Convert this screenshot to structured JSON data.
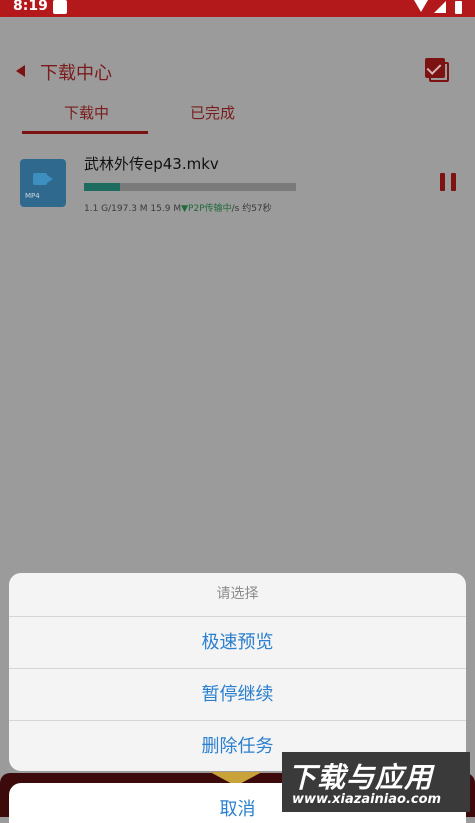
{
  "status_bar": {
    "time": "8:19"
  },
  "header": {
    "title": "下载中心"
  },
  "tabs": {
    "downloading": "下载中",
    "completed": "已完成"
  },
  "download": {
    "file_name": "武林外传ep43.mkv",
    "file_type": "MP4",
    "progress": 0.17,
    "size_info": "1.1 G/197.3 M 15.9 M",
    "p2p": "▼P2P传输中",
    "speed_suffix": "/s 约57秒"
  },
  "sheet": {
    "title": "请选择",
    "options": [
      "极速预览",
      "暂停继续",
      "删除任务"
    ],
    "cancel": "取消"
  },
  "watermark": {
    "main": "下载与应用",
    "sub": "www.xiazainiao.com"
  }
}
